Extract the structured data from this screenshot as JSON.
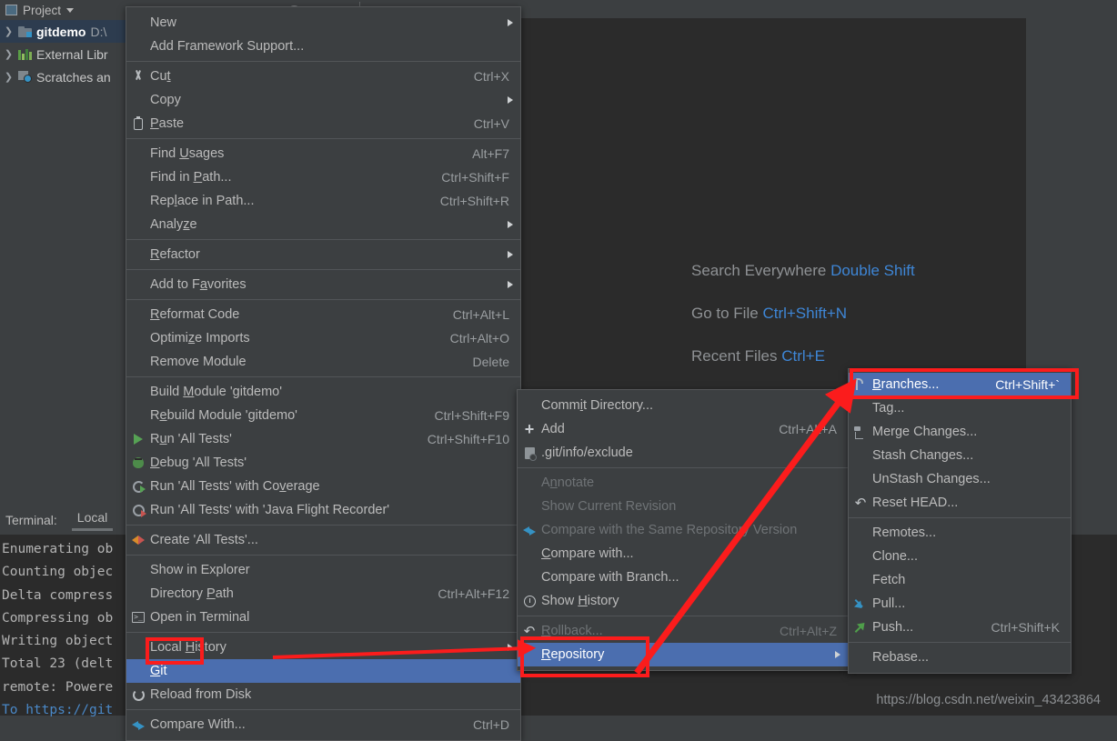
{
  "sidebar": {
    "title": "Project",
    "caret_icon": "chevron-down-icon",
    "items": [
      {
        "label": "gitdemo",
        "sub": "D:\\",
        "icon": "folder-module-icon",
        "selected": true
      },
      {
        "label": "External Libr",
        "sub": "",
        "icon": "library-icon",
        "selected": false
      },
      {
        "label": "Scratches an",
        "sub": "",
        "icon": "scratches-icon",
        "selected": false
      }
    ]
  },
  "editor_hints": [
    {
      "label": "Search Everywhere",
      "key": "Double Shift"
    },
    {
      "label": "Go to File",
      "key": "Ctrl+Shift+N"
    },
    {
      "label": "Recent Files",
      "key": "Ctrl+E"
    }
  ],
  "terminal": {
    "label": "Terminal:",
    "tab": "Local",
    "lines": [
      {
        "text": "Enumerating ob",
        "link": false
      },
      {
        "text": "Counting objec",
        "link": false
      },
      {
        "text": "Delta compress",
        "link": false
      },
      {
        "text": "Compressing ob",
        "link": false
      },
      {
        "text": "Writing object",
        "link": false
      },
      {
        "text": "Total 23 (delt",
        "link": false
      },
      {
        "text": "remote: Powere",
        "link": false
      },
      {
        "text": "To https://git",
        "link": true
      }
    ]
  },
  "context_menu": {
    "items": [
      {
        "label": "New",
        "accel": "",
        "icon": "",
        "submenu": true,
        "disabled": false,
        "mnemonic": ""
      },
      {
        "label": "Add Framework Support...",
        "accel": "",
        "icon": "",
        "submenu": false,
        "disabled": false,
        "mnemonic": ""
      },
      {
        "separator": true
      },
      {
        "label": "Cut",
        "accel": "Ctrl+X",
        "icon": "scissors-icon",
        "submenu": false,
        "disabled": false,
        "mnemonic": "t"
      },
      {
        "label": "Copy",
        "accel": "",
        "icon": "",
        "submenu": true,
        "disabled": false,
        "mnemonic": ""
      },
      {
        "label": "Paste",
        "accel": "Ctrl+V",
        "icon": "clipboard-icon",
        "submenu": false,
        "disabled": false,
        "mnemonic": "P"
      },
      {
        "separator": true
      },
      {
        "label": "Find Usages",
        "accel": "Alt+F7",
        "icon": "",
        "submenu": false,
        "disabled": false,
        "mnemonic": "U"
      },
      {
        "label": "Find in Path...",
        "accel": "Ctrl+Shift+F",
        "icon": "",
        "submenu": false,
        "disabled": false,
        "mnemonic": "P"
      },
      {
        "label": "Replace in Path...",
        "accel": "Ctrl+Shift+R",
        "icon": "",
        "submenu": false,
        "disabled": false,
        "mnemonic": "l"
      },
      {
        "label": "Analyze",
        "accel": "",
        "icon": "",
        "submenu": true,
        "disabled": false,
        "mnemonic": "z"
      },
      {
        "separator": true
      },
      {
        "label": "Refactor",
        "accel": "",
        "icon": "",
        "submenu": true,
        "disabled": false,
        "mnemonic": "R"
      },
      {
        "separator": true
      },
      {
        "label": "Add to Favorites",
        "accel": "",
        "icon": "",
        "submenu": true,
        "disabled": false,
        "mnemonic": "a"
      },
      {
        "separator": true
      },
      {
        "label": "Reformat Code",
        "accel": "Ctrl+Alt+L",
        "icon": "",
        "submenu": false,
        "disabled": false,
        "mnemonic": "R"
      },
      {
        "label": "Optimize Imports",
        "accel": "Ctrl+Alt+O",
        "icon": "",
        "submenu": false,
        "disabled": false,
        "mnemonic": "z"
      },
      {
        "label": "Remove Module",
        "accel": "Delete",
        "icon": "",
        "submenu": false,
        "disabled": false,
        "mnemonic": ""
      },
      {
        "separator": true
      },
      {
        "label": "Build Module 'gitdemo'",
        "accel": "",
        "icon": "",
        "submenu": false,
        "disabled": false,
        "mnemonic": "M"
      },
      {
        "label": "Rebuild Module 'gitdemo'",
        "accel": "Ctrl+Shift+F9",
        "icon": "",
        "submenu": false,
        "disabled": false,
        "mnemonic": "e"
      },
      {
        "label": "Run 'All Tests'",
        "accel": "Ctrl+Shift+F10",
        "icon": "run-icon",
        "submenu": false,
        "disabled": false,
        "mnemonic": "u"
      },
      {
        "label": "Debug 'All Tests'",
        "accel": "",
        "icon": "debug-icon",
        "submenu": false,
        "disabled": false,
        "mnemonic": "D"
      },
      {
        "label": "Run 'All Tests' with Coverage",
        "accel": "",
        "icon": "coverage-icon",
        "submenu": false,
        "disabled": false,
        "mnemonic": "v"
      },
      {
        "label": "Run 'All Tests' with 'Java Flight Recorder'",
        "accel": "",
        "icon": "jfr-icon",
        "submenu": false,
        "disabled": false,
        "mnemonic": ""
      },
      {
        "separator": true
      },
      {
        "label": "Create 'All Tests'...",
        "accel": "",
        "icon": "create-config-icon",
        "submenu": false,
        "disabled": false,
        "mnemonic": ""
      },
      {
        "separator": true
      },
      {
        "label": "Show in Explorer",
        "accel": "",
        "icon": "",
        "submenu": false,
        "disabled": false,
        "mnemonic": ""
      },
      {
        "label": "Directory Path",
        "accel": "Ctrl+Alt+F12",
        "icon": "",
        "submenu": false,
        "disabled": false,
        "mnemonic": "P"
      },
      {
        "label": "Open in Terminal",
        "accel": "",
        "icon": "terminal-icon",
        "submenu": false,
        "disabled": false,
        "mnemonic": ""
      },
      {
        "separator": true
      },
      {
        "label": "Local History",
        "accel": "",
        "icon": "",
        "submenu": true,
        "disabled": false,
        "mnemonic": "H"
      },
      {
        "label": "Git",
        "accel": "",
        "icon": "",
        "submenu": false,
        "disabled": false,
        "mnemonic": "G",
        "highlighted": true
      },
      {
        "label": "Reload from Disk",
        "accel": "",
        "icon": "reload-icon",
        "submenu": false,
        "disabled": false,
        "mnemonic": ""
      },
      {
        "separator": true
      },
      {
        "label": "Compare With...",
        "accel": "Ctrl+D",
        "icon": "compare-icon",
        "submenu": false,
        "disabled": false,
        "mnemonic": ""
      }
    ]
  },
  "git_menu": {
    "items": [
      {
        "label": "Commit Directory...",
        "accel": "",
        "icon": "",
        "submenu": false,
        "disabled": false,
        "mnemonic": "i"
      },
      {
        "label": "Add",
        "accel": "Ctrl+Alt+A",
        "icon": "plus-icon",
        "submenu": false,
        "disabled": false,
        "mnemonic": ""
      },
      {
        "label": ".git/info/exclude",
        "accel": "",
        "icon": "exclude-icon",
        "submenu": false,
        "disabled": false,
        "mnemonic": ""
      },
      {
        "separator": true
      },
      {
        "label": "Annotate",
        "accel": "",
        "icon": "",
        "submenu": false,
        "disabled": true,
        "mnemonic": "n"
      },
      {
        "label": "Show Current Revision",
        "accel": "",
        "icon": "",
        "submenu": false,
        "disabled": true,
        "mnemonic": ""
      },
      {
        "label": "Compare with the Same Repository Version",
        "accel": "",
        "icon": "compare-icon",
        "submenu": false,
        "disabled": true,
        "mnemonic": ""
      },
      {
        "label": "Compare with...",
        "accel": "",
        "icon": "",
        "submenu": false,
        "disabled": false,
        "mnemonic": "C"
      },
      {
        "label": "Compare with Branch...",
        "accel": "",
        "icon": "",
        "submenu": false,
        "disabled": false,
        "mnemonic": ""
      },
      {
        "label": "Show History",
        "accel": "",
        "icon": "clock-icon",
        "submenu": false,
        "disabled": false,
        "mnemonic": "H"
      },
      {
        "separator": true
      },
      {
        "label": "Rollback...",
        "accel": "Ctrl+Alt+Z",
        "icon": "undo-icon",
        "submenu": false,
        "disabled": true,
        "mnemonic": "R"
      },
      {
        "label": "Repository",
        "accel": "",
        "icon": "",
        "submenu": true,
        "disabled": false,
        "mnemonic": "R",
        "highlighted": true
      }
    ]
  },
  "repository_menu": {
    "items": [
      {
        "label": "Branches...",
        "accel": "Ctrl+Shift+`",
        "icon": "branch-icon",
        "submenu": false,
        "disabled": false,
        "mnemonic": "B",
        "highlighted": true
      },
      {
        "label": "Tag...",
        "accel": "",
        "icon": "",
        "submenu": false,
        "disabled": false,
        "mnemonic": ""
      },
      {
        "label": "Merge Changes...",
        "accel": "",
        "icon": "merge-icon",
        "submenu": false,
        "disabled": false,
        "mnemonic": ""
      },
      {
        "label": "Stash Changes...",
        "accel": "",
        "icon": "",
        "submenu": false,
        "disabled": false,
        "mnemonic": ""
      },
      {
        "label": "UnStash Changes...",
        "accel": "",
        "icon": "",
        "submenu": false,
        "disabled": false,
        "mnemonic": ""
      },
      {
        "label": "Reset HEAD...",
        "accel": "",
        "icon": "undo-icon",
        "submenu": false,
        "disabled": false,
        "mnemonic": ""
      },
      {
        "separator": true
      },
      {
        "label": "Remotes...",
        "accel": "",
        "icon": "",
        "submenu": false,
        "disabled": false,
        "mnemonic": ""
      },
      {
        "label": "Clone...",
        "accel": "",
        "icon": "",
        "submenu": false,
        "disabled": false,
        "mnemonic": ""
      },
      {
        "label": "Fetch",
        "accel": "",
        "icon": "",
        "submenu": false,
        "disabled": false,
        "mnemonic": ""
      },
      {
        "label": "Pull...",
        "accel": "",
        "icon": "pull-icon",
        "submenu": false,
        "disabled": false,
        "mnemonic": ""
      },
      {
        "label": "Push...",
        "accel": "Ctrl+Shift+K",
        "icon": "push-icon",
        "submenu": false,
        "disabled": false,
        "mnemonic": ""
      },
      {
        "separator": true
      },
      {
        "label": "Rebase...",
        "accel": "",
        "icon": "",
        "submenu": false,
        "disabled": false,
        "mnemonic": ""
      }
    ]
  },
  "annotations": {
    "color": "#fb1c1c",
    "highlight_color": "#4b6eaf",
    "boxes": [
      "git-item-box",
      "repository-item-box",
      "branches-item-box"
    ],
    "arrows": [
      "git-to-repository-arrow",
      "repository-to-branches-arrow"
    ]
  },
  "watermark": "https://blog.csdn.net/weixin_43423864"
}
